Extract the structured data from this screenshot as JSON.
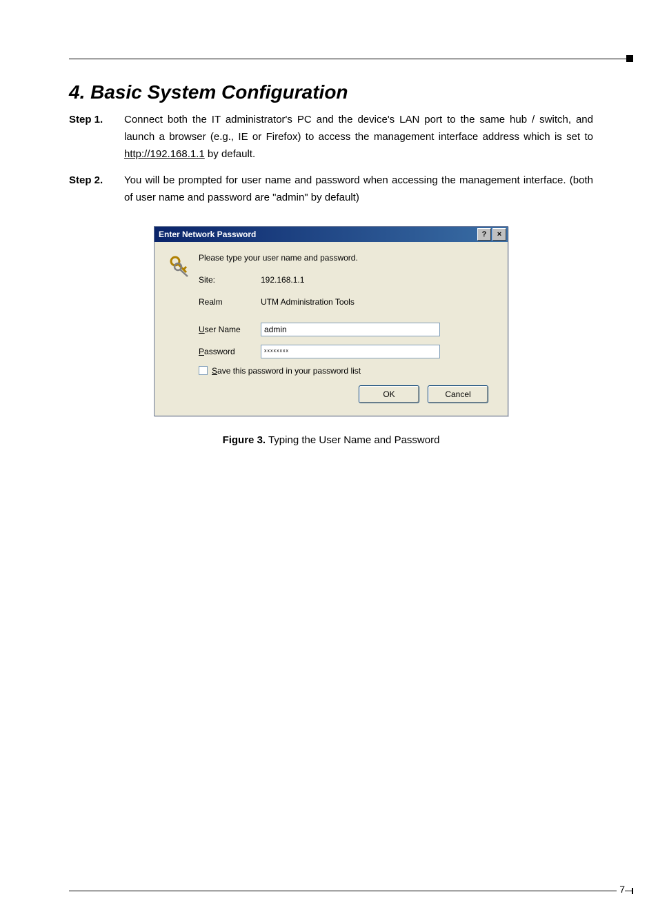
{
  "section": {
    "title": "4. Basic System Configuration"
  },
  "steps": [
    {
      "label": "Step 1.",
      "text_before_url": "Connect both the IT administrator's PC and the device's LAN port to the same hub / switch, and launch a browser (e.g., IE or Firefox) to access the management interface address which is set to ",
      "url": "http://192.168.1.1",
      "text_after_url": " by default."
    },
    {
      "label": "Step 2.",
      "text": "You will be prompted for user name and password when accessing the management interface. (both of user name and password are \"admin\" by default)"
    }
  ],
  "dialog": {
    "title": "Enter Network Password",
    "help_glyph": "?",
    "close_glyph": "×",
    "prompt": "Please type your user name and password.",
    "site_label": "Site:",
    "site_value": "192.168.1.1",
    "realm_label": "Realm",
    "realm_value": "UTM Administration Tools",
    "user_label": "User Name",
    "user_value": "admin",
    "password_label": "Password",
    "password_value": "xxxxxxxx",
    "save_label": "Save this password in your password list",
    "ok_label": "OK",
    "cancel_label": "Cancel"
  },
  "figure": {
    "label": "Figure 3.",
    "caption": "  Typing the User Name and Password"
  },
  "page_number": "7"
}
